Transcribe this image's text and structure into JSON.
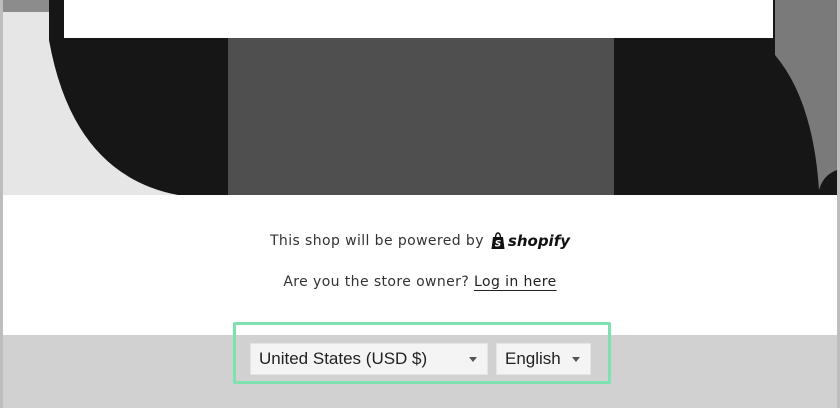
{
  "footer_text": {
    "powered_prefix": "This shop will be powered by",
    "shopify_brand": "shopify",
    "owner_question": "Are you the store owner?",
    "login_link": "Log in here"
  },
  "selectors": {
    "country": {
      "value": "United States (USD $)",
      "icon": "chevron-down-icon"
    },
    "language": {
      "value": "English",
      "icon": "chevron-down-icon"
    }
  },
  "colors": {
    "highlight_border": "#7fe0b0",
    "footer_bar": "#d1d1d1",
    "hero_dark": "#161616",
    "hero_mid": "#4f4f4f"
  }
}
